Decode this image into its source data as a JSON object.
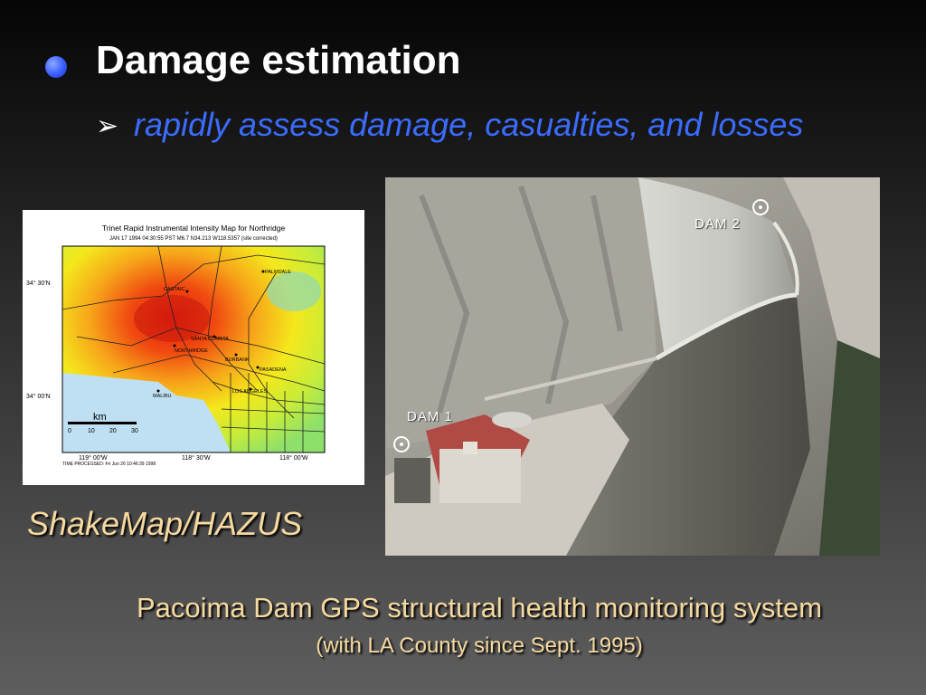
{
  "slide": {
    "heading": "Damage estimation",
    "subpoint": "rapidly assess damage, casualties, and losses",
    "map_caption": "ShakeMap/HAZUS",
    "caption_main": "Pacoima Dam GPS structural health monitoring system",
    "caption_sub": "(with LA County since Sept. 1995)"
  },
  "shakemap": {
    "title": "Trinet Rapid Instrumental Intensity Map for Northridge",
    "subtitle": "JAN 17 1994 04:30:55 PST M6.7 N34.213 W118.5357 (site corrected)",
    "lat_labels": [
      "34° 30'N",
      "34° 00'N"
    ],
    "lon_labels": [
      "119° 00'W",
      "118° 30'W",
      "118° 00'W"
    ],
    "places": [
      "PALMDALE",
      "CASTAIC",
      "SANTA CLARITA",
      "NORTHRIDGE",
      "BURBANK",
      "PASADENA",
      "LOS ANGELES",
      "MALIBU"
    ],
    "scale_unit": "km",
    "scale_ticks": [
      "0",
      "10",
      "20",
      "30"
    ],
    "time_processed": "TIME PROCESSED: Fri Jun 26 10:46:39 1998"
  },
  "photo": {
    "dam1_label": "DAM 1",
    "dam2_label": "DAM 2"
  },
  "colors": {
    "heading": "#ffffff",
    "subpoint": "#3b6cff",
    "caption": "#f5d9a0",
    "bullet": "#3a5cff"
  },
  "icons": {
    "bullet": "blue-circle-bullet-icon",
    "subbullet": "arrowhead-bullet-icon",
    "marker": "gps-station-marker-icon"
  }
}
